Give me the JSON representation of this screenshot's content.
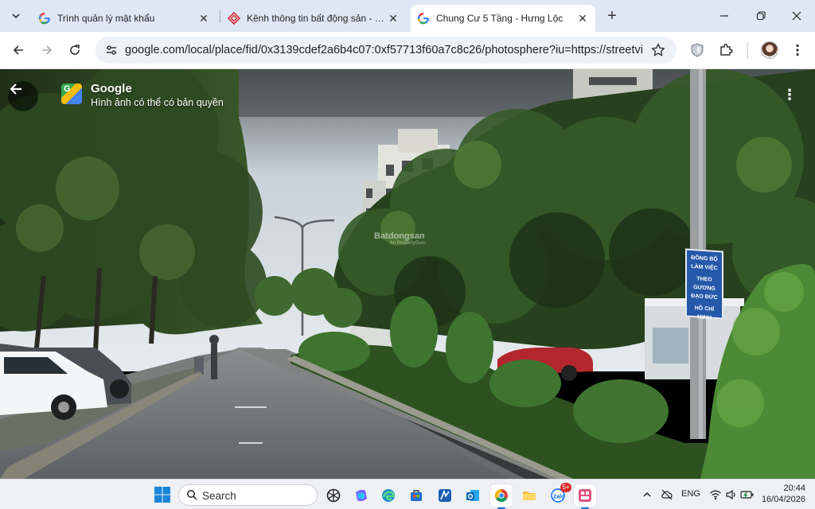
{
  "browser": {
    "tabs": [
      {
        "title": "Trình quản lý mật khẩu",
        "icon": "google-g-icon",
        "active": false
      },
      {
        "title": "Kênh thông tin bất động sản - Mua b",
        "icon": "batdongsan-icon",
        "active": false
      },
      {
        "title": "Chung Cư 5 Tầng - Hưng Lộc",
        "icon": "google-g-icon",
        "active": true
      }
    ],
    "url": "google.com/local/place/fid/0x3139cdef2a6b4c07:0xf57713f60a7c8c26/photosphere?iu=https://streetvi...",
    "controls": {
      "tab_menu": "chevron-down-icon",
      "new_tab": "+",
      "minimize": "minimize-icon",
      "maximize": "restore-icon",
      "close": "close-icon"
    }
  },
  "viewer": {
    "title": "Google",
    "subtitle": "Hình ảnh có thể có bản quyền",
    "watermark": "Batdongsan",
    "watermark_sub": "An PropertyGuru",
    "sign_text": [
      "ĐỒNG BỘ LÀM VIỆC",
      "THEO GƯƠNG ĐẠO ĐỨC",
      "HỒ CHÍ MINH"
    ]
  },
  "taskbar": {
    "search_label": "Search",
    "language": "ENG",
    "time": "20:44",
    "date": "16/04/2026",
    "zalo_badge": "5+",
    "apps": [
      "chatgpt-icon",
      "copilot-icon",
      "edge-icon",
      "store-icon",
      "maps-icon",
      "outlook-icon",
      "chrome-icon",
      "file-explorer-icon",
      "zalo-icon",
      "batdongsan-app-icon"
    ]
  }
}
